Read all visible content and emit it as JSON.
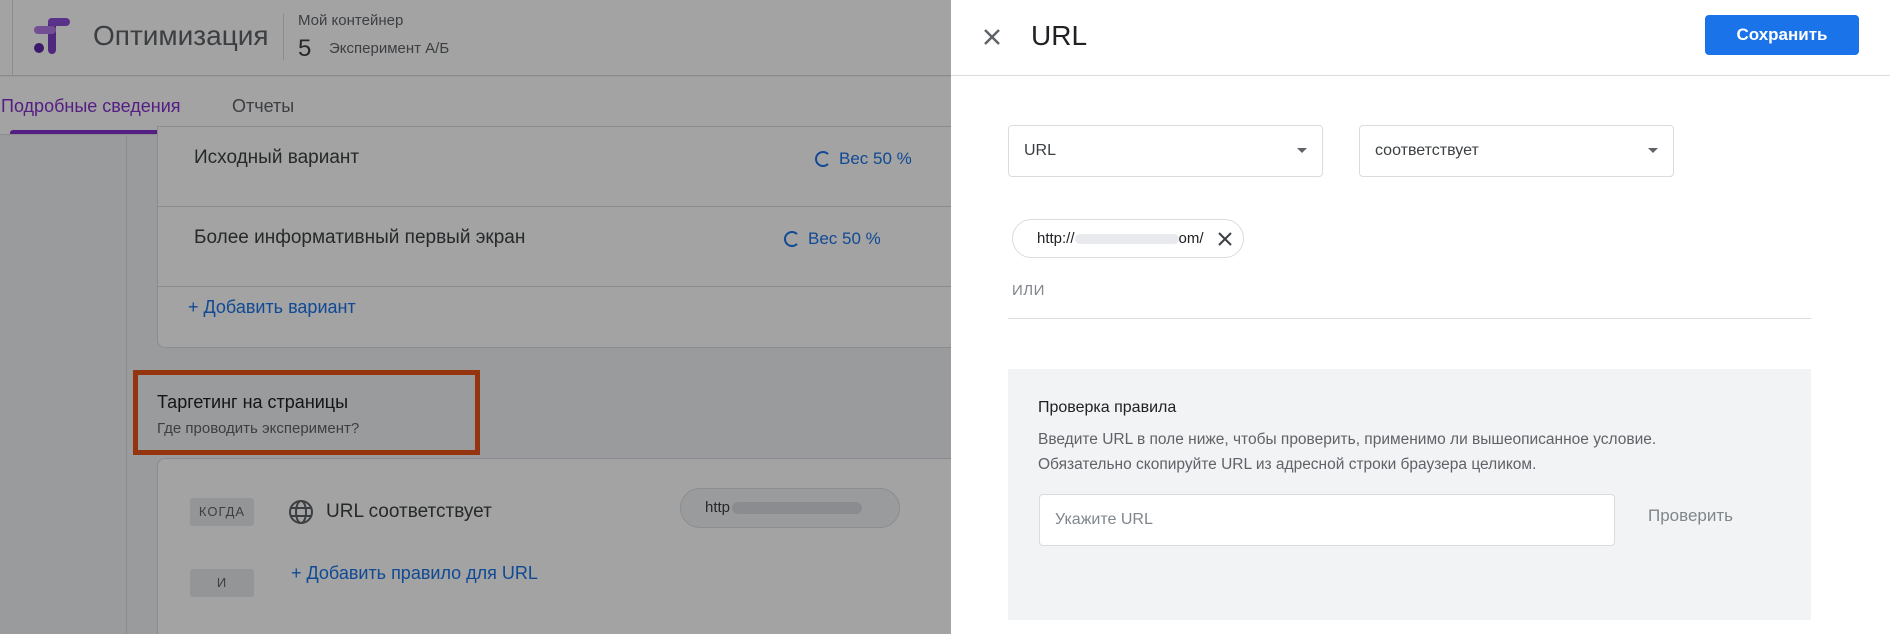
{
  "app": {
    "title": "Оптимизация",
    "container_label": "Мой контейнер",
    "container_number": "5",
    "experiment_type": "Эксперимент А/Б"
  },
  "tabs": [
    {
      "label": "Подробные сведения",
      "active": true
    },
    {
      "label": "Отчеты",
      "active": false
    }
  ],
  "variants": [
    {
      "name": "Исходный вариант",
      "weight": "Вес 50 %"
    },
    {
      "name": "Более информативный первый экран",
      "weight": "Вес 50 %"
    }
  ],
  "add_variant_label": "+ Добавить вариант",
  "targeting": {
    "title": "Таргетинг на страницы",
    "subtitle": "Где проводить эксперимент?",
    "when_chip": "КОГДА",
    "and_chip": "И",
    "rule_text": "URL соответствует",
    "rule_url_prefix": "http",
    "add_rule_label": "+ Добавить правило для URL"
  },
  "panel": {
    "title": "URL",
    "save_label": "Сохранить",
    "field_select": "URL",
    "operator_select": "соответствует",
    "value_chip_prefix": "http://",
    "value_chip_suffix": "om/",
    "or_label": "ИЛИ",
    "check": {
      "title": "Проверка правила",
      "desc_line1": "Введите URL в поле ниже, чтобы проверить, применимо ли вышеописанное условие.",
      "desc_line2": "Обязательно скопируйте URL из адресной строки браузера целиком.",
      "input_placeholder": "Укажите URL",
      "button_label": "Проверить"
    }
  },
  "colors": {
    "accent": "#1a73e8",
    "active_tab": "#8430ce",
    "highlight": "#e8541a"
  }
}
